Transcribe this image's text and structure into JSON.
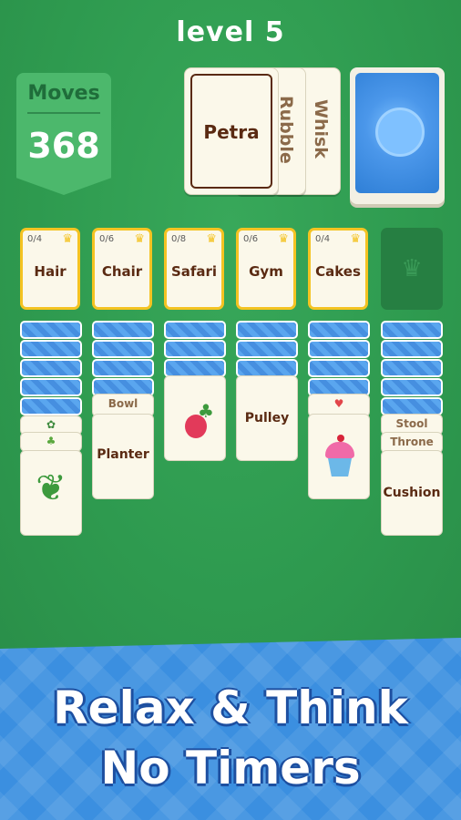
{
  "header": {
    "level_label": "level",
    "level_number": "5"
  },
  "moves": {
    "label": "Moves",
    "value": "368"
  },
  "waste": {
    "front": "Petra",
    "second": "Rubble",
    "third": "Whisk"
  },
  "foundations": [
    {
      "count": "0/4",
      "name": "Hair"
    },
    {
      "count": "0/6",
      "name": "Chair"
    },
    {
      "count": "0/8",
      "name": "Safari"
    },
    {
      "count": "0/6",
      "name": "Gym"
    },
    {
      "count": "0/4",
      "name": "Cakes"
    }
  ],
  "tableau": {
    "col2_small": "Bowl",
    "col2_card": "Planter",
    "col4_card": "Pulley",
    "col6_small1": "Stool",
    "col6_small2": "Throne",
    "col6_card": "Cushion"
  },
  "banner": {
    "line1": "Relax & Think",
    "line2": "No Timers"
  },
  "colors": {
    "felt": "#2f9a4f",
    "card": "#fbf8ea",
    "gold": "#f4c322",
    "card_back": "#4b97ea",
    "banner": "#3b8fe0"
  }
}
